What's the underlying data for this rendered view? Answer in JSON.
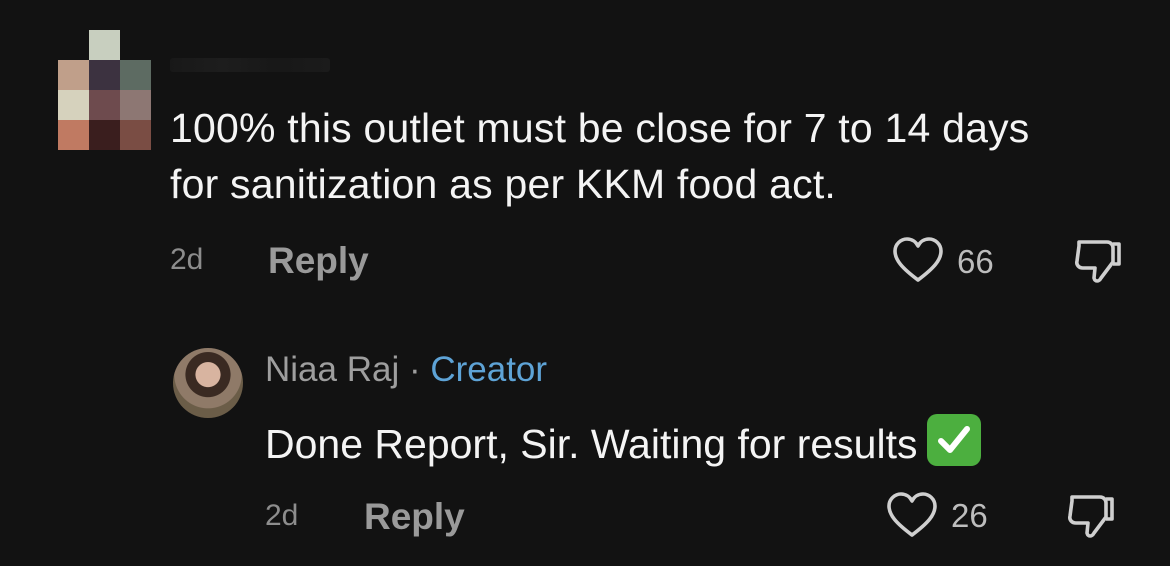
{
  "comment": {
    "text": "100% this outlet must be close for 7 to 14 days for sanitization as per KKM food act.",
    "time": "2d",
    "reply_label": "Reply",
    "likes": "66"
  },
  "reply": {
    "author": "Niaa Raj",
    "separator": " · ",
    "badge": "Creator",
    "text": "Done Report, Sir. Waiting for results",
    "time": "2d",
    "reply_label": "Reply",
    "likes": "26"
  },
  "colors": {
    "background": "#121212",
    "creator_badge": "#5ea3d6",
    "check_emoji": "#4caf3f"
  },
  "icons": {
    "like": "heart-outline-icon",
    "dislike": "thumbs-down-outline-icon",
    "emoji": "check-mark-button-emoji"
  }
}
